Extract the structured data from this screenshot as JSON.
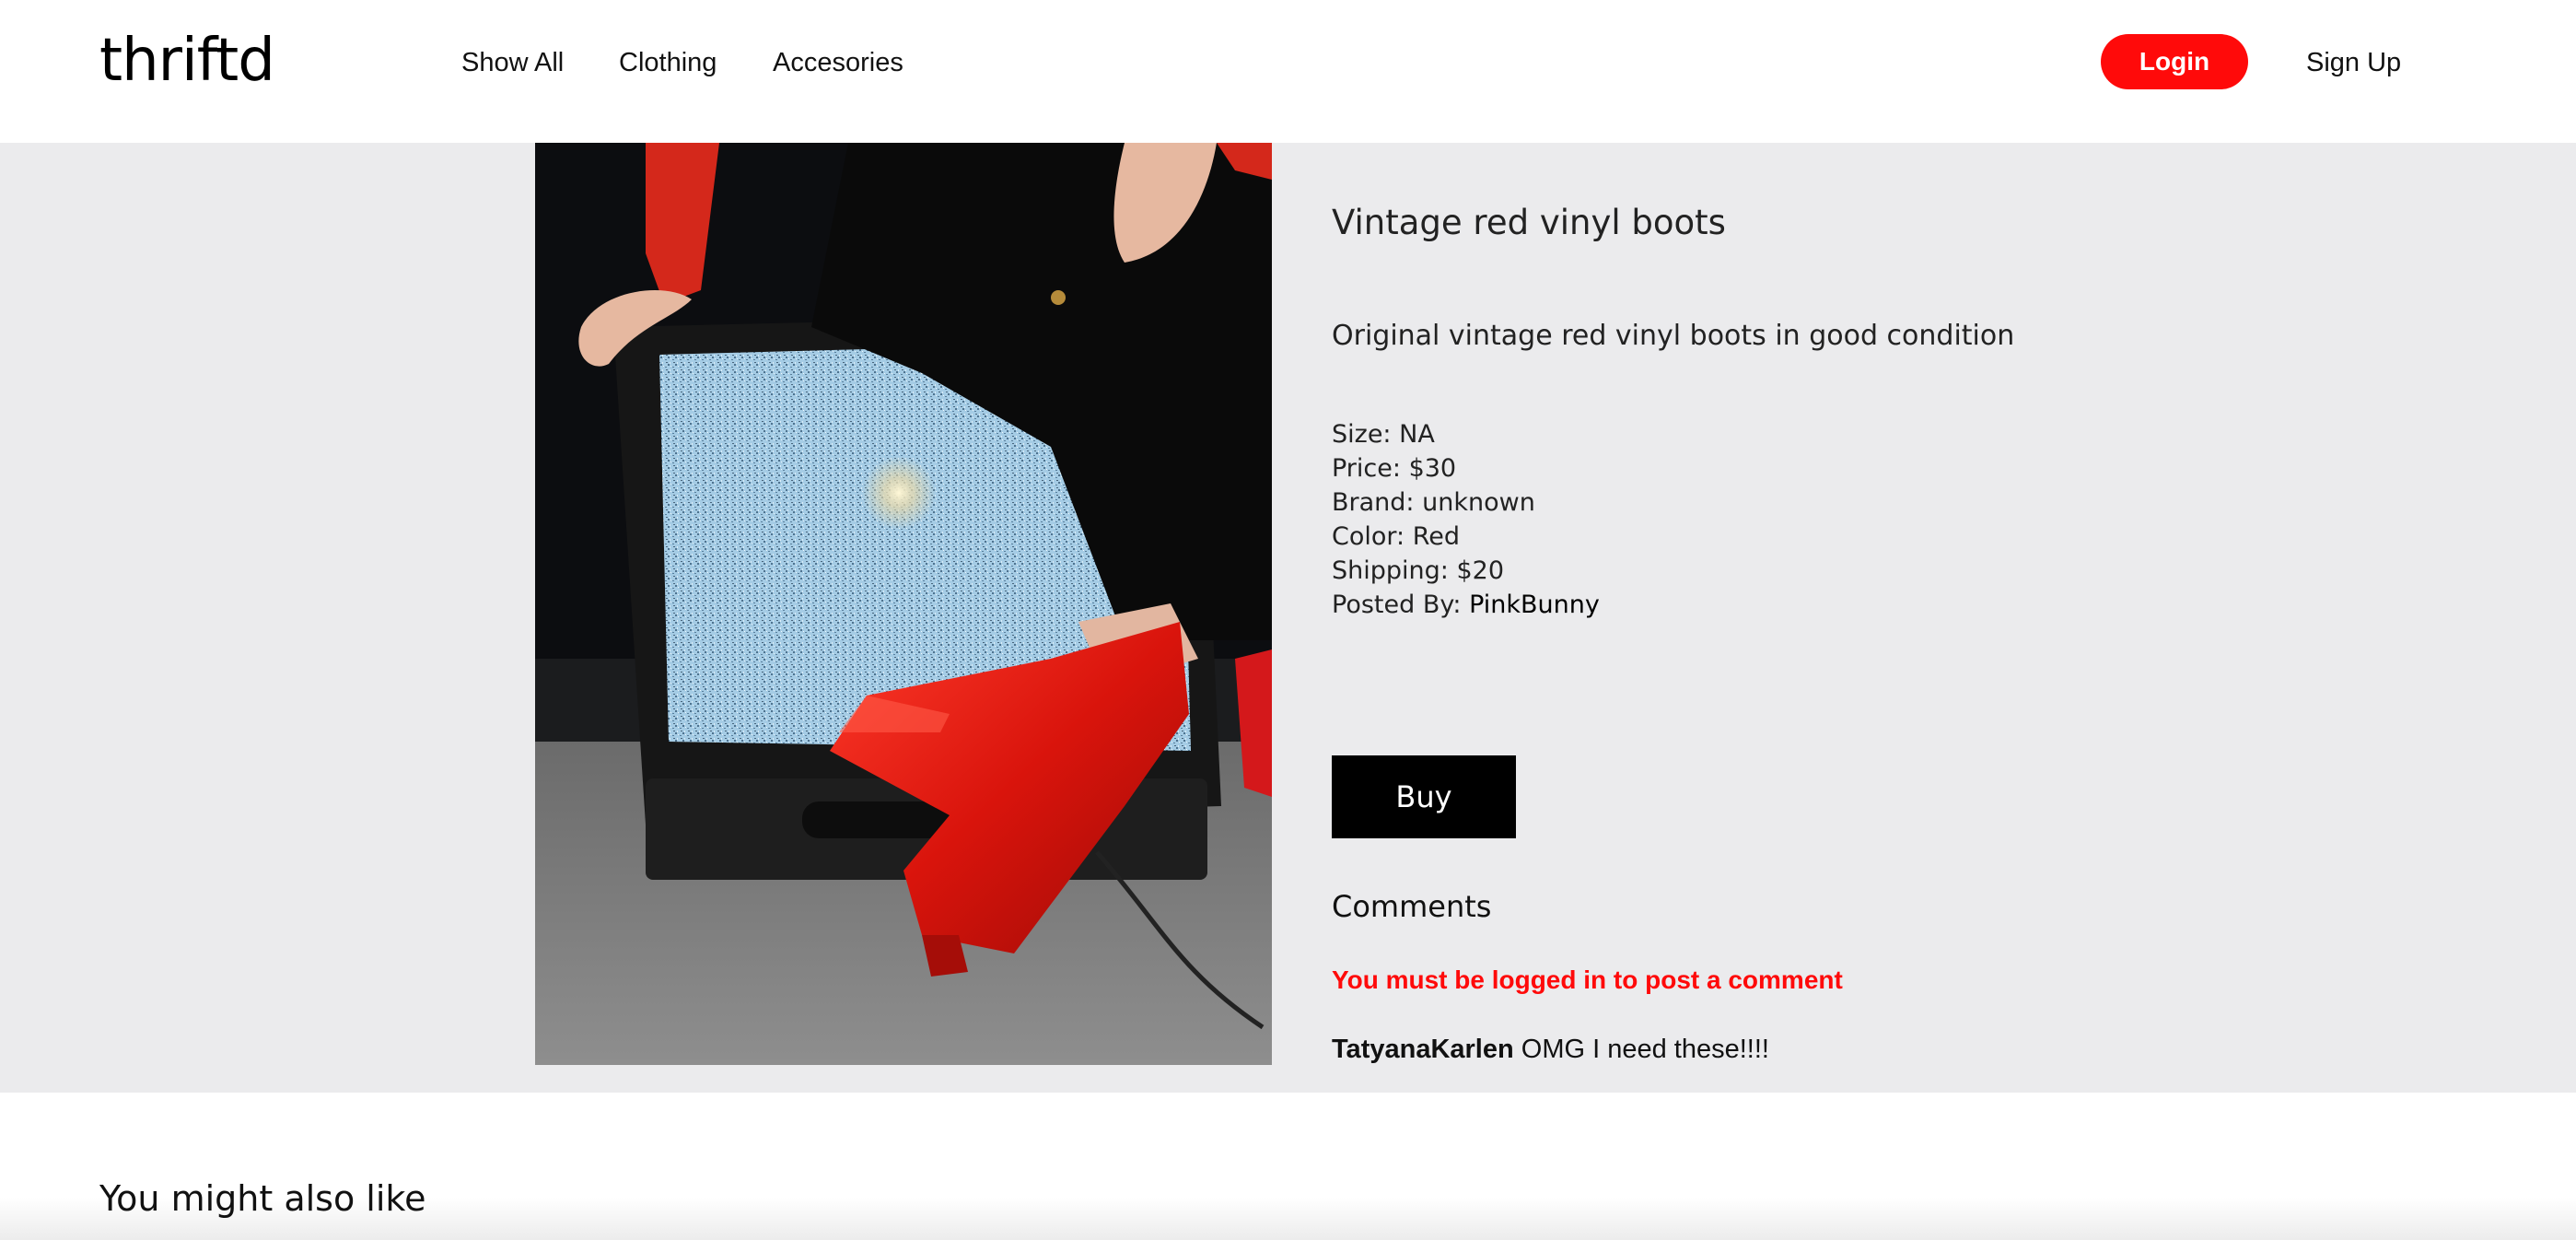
{
  "brand": {
    "logo_text": "thriftd"
  },
  "nav": {
    "items": [
      {
        "label": "Show All"
      },
      {
        "label": "Clothing"
      },
      {
        "label": "Accesories"
      }
    ],
    "login_label": "Login",
    "signup_label": "Sign Up"
  },
  "product": {
    "title": "Vintage red vinyl boots",
    "description": "Original vintage red vinyl boots in good condition",
    "specs": {
      "size_label": "Size:",
      "size": "NA",
      "price_label": "Price:",
      "price": "$30",
      "brand_label": "Brand:",
      "brand": "unknown",
      "color_label": "Color:",
      "color": "Red",
      "shipping_label": "Shipping:",
      "shipping": "$20",
      "posted_by_label": "Posted By:",
      "posted_by": "PinkBunny"
    },
    "buy_label": "Buy"
  },
  "comments": {
    "heading": "Comments",
    "login_warning": "You must be logged in to post a comment",
    "items": [
      {
        "author": "TatyanaKarlen",
        "text": "OMG I need these!!!!"
      }
    ]
  },
  "recommendations": {
    "heading": "You might also like"
  },
  "colors": {
    "accent": "#ff0a0a",
    "band_background": "#ebebed",
    "buy_button": "#000000"
  }
}
